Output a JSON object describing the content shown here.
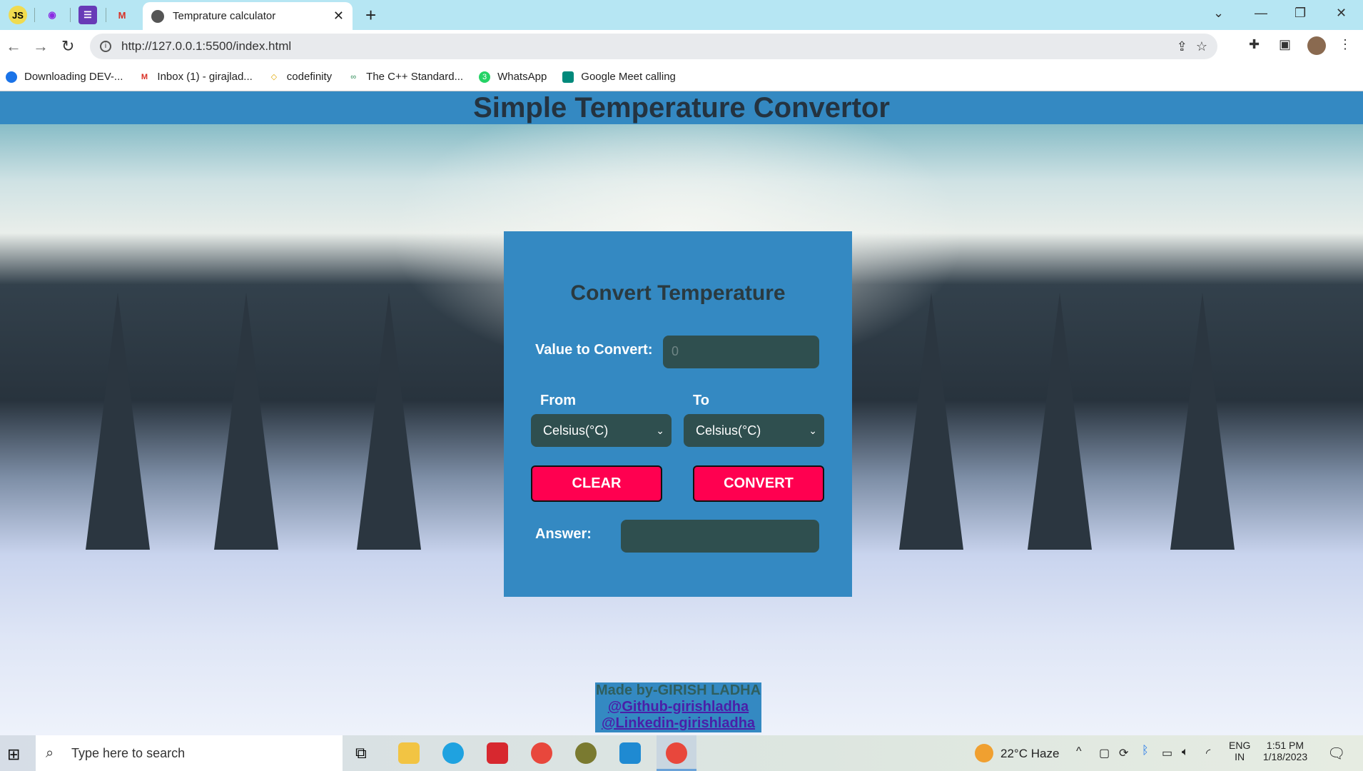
{
  "browser": {
    "tab_title": "Temprature calculator",
    "url": "http://127.0.0.1:5500/index.html",
    "pinned_tabs": [
      "js-icon",
      "podcast-icon",
      "forms-icon",
      "gmail-icon"
    ],
    "bookmarks": [
      {
        "label": "Downloading DEV-...",
        "icon": "loader-icon"
      },
      {
        "label": "Inbox (1) - girajlad...",
        "icon": "gmail-icon"
      },
      {
        "label": "codefinity",
        "icon": "codefinity-icon"
      },
      {
        "label": "The C++ Standard...",
        "icon": "cpp-icon"
      },
      {
        "label": "WhatsApp",
        "icon": "whatsapp-icon"
      },
      {
        "label": "Google Meet calling",
        "icon": "meet-icon"
      }
    ]
  },
  "page": {
    "header": "Simple Temperature Convertor",
    "card": {
      "title": "Convert Temperature",
      "value_label": "Value to Convert:",
      "value_placeholder": "0",
      "from_label": "From",
      "to_label": "To",
      "from_selected": "Celsius(°C)",
      "to_selected": "Celsius(°C)",
      "clear": "CLEAR",
      "convert": "CONVERT",
      "answer_label": "Answer:",
      "answer_value": ""
    },
    "footer": {
      "made_by": "Made by-GIRISH LADHA",
      "github": "@Github-girishladha",
      "linkedin": "@Linkedin-girishladha"
    }
  },
  "taskbar": {
    "search_placeholder": "Type here to search",
    "weather": "22°C  Haze",
    "lang1": "ENG",
    "lang2": "IN",
    "time": "1:51 PM",
    "date": "1/18/2023"
  },
  "colors": {
    "accent": "#3489c2",
    "button": "#ff0050",
    "field": "#2f4f4f"
  }
}
